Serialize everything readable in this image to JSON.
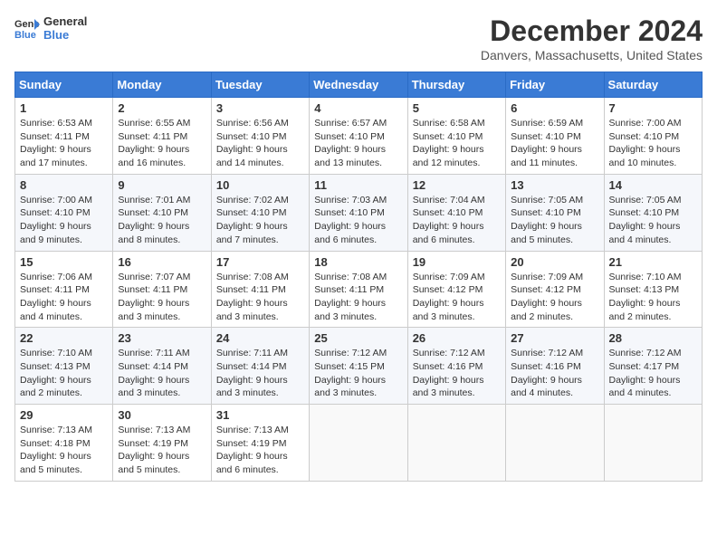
{
  "logo": {
    "line1": "General",
    "line2": "Blue"
  },
  "title": "December 2024",
  "location": "Danvers, Massachusetts, United States",
  "days_header": [
    "Sunday",
    "Monday",
    "Tuesday",
    "Wednesday",
    "Thursday",
    "Friday",
    "Saturday"
  ],
  "weeks": [
    [
      {
        "day": "1",
        "info": "Sunrise: 6:53 AM\nSunset: 4:11 PM\nDaylight: 9 hours\nand 17 minutes."
      },
      {
        "day": "2",
        "info": "Sunrise: 6:55 AM\nSunset: 4:11 PM\nDaylight: 9 hours\nand 16 minutes."
      },
      {
        "day": "3",
        "info": "Sunrise: 6:56 AM\nSunset: 4:10 PM\nDaylight: 9 hours\nand 14 minutes."
      },
      {
        "day": "4",
        "info": "Sunrise: 6:57 AM\nSunset: 4:10 PM\nDaylight: 9 hours\nand 13 minutes."
      },
      {
        "day": "5",
        "info": "Sunrise: 6:58 AM\nSunset: 4:10 PM\nDaylight: 9 hours\nand 12 minutes."
      },
      {
        "day": "6",
        "info": "Sunrise: 6:59 AM\nSunset: 4:10 PM\nDaylight: 9 hours\nand 11 minutes."
      },
      {
        "day": "7",
        "info": "Sunrise: 7:00 AM\nSunset: 4:10 PM\nDaylight: 9 hours\nand 10 minutes."
      }
    ],
    [
      {
        "day": "8",
        "info": "Sunrise: 7:00 AM\nSunset: 4:10 PM\nDaylight: 9 hours\nand 9 minutes."
      },
      {
        "day": "9",
        "info": "Sunrise: 7:01 AM\nSunset: 4:10 PM\nDaylight: 9 hours\nand 8 minutes."
      },
      {
        "day": "10",
        "info": "Sunrise: 7:02 AM\nSunset: 4:10 PM\nDaylight: 9 hours\nand 7 minutes."
      },
      {
        "day": "11",
        "info": "Sunrise: 7:03 AM\nSunset: 4:10 PM\nDaylight: 9 hours\nand 6 minutes."
      },
      {
        "day": "12",
        "info": "Sunrise: 7:04 AM\nSunset: 4:10 PM\nDaylight: 9 hours\nand 6 minutes."
      },
      {
        "day": "13",
        "info": "Sunrise: 7:05 AM\nSunset: 4:10 PM\nDaylight: 9 hours\nand 5 minutes."
      },
      {
        "day": "14",
        "info": "Sunrise: 7:05 AM\nSunset: 4:10 PM\nDaylight: 9 hours\nand 4 minutes."
      }
    ],
    [
      {
        "day": "15",
        "info": "Sunrise: 7:06 AM\nSunset: 4:11 PM\nDaylight: 9 hours\nand 4 minutes."
      },
      {
        "day": "16",
        "info": "Sunrise: 7:07 AM\nSunset: 4:11 PM\nDaylight: 9 hours\nand 3 minutes."
      },
      {
        "day": "17",
        "info": "Sunrise: 7:08 AM\nSunset: 4:11 PM\nDaylight: 9 hours\nand 3 minutes."
      },
      {
        "day": "18",
        "info": "Sunrise: 7:08 AM\nSunset: 4:11 PM\nDaylight: 9 hours\nand 3 minutes."
      },
      {
        "day": "19",
        "info": "Sunrise: 7:09 AM\nSunset: 4:12 PM\nDaylight: 9 hours\nand 3 minutes."
      },
      {
        "day": "20",
        "info": "Sunrise: 7:09 AM\nSunset: 4:12 PM\nDaylight: 9 hours\nand 2 minutes."
      },
      {
        "day": "21",
        "info": "Sunrise: 7:10 AM\nSunset: 4:13 PM\nDaylight: 9 hours\nand 2 minutes."
      }
    ],
    [
      {
        "day": "22",
        "info": "Sunrise: 7:10 AM\nSunset: 4:13 PM\nDaylight: 9 hours\nand 2 minutes."
      },
      {
        "day": "23",
        "info": "Sunrise: 7:11 AM\nSunset: 4:14 PM\nDaylight: 9 hours\nand 3 minutes."
      },
      {
        "day": "24",
        "info": "Sunrise: 7:11 AM\nSunset: 4:14 PM\nDaylight: 9 hours\nand 3 minutes."
      },
      {
        "day": "25",
        "info": "Sunrise: 7:12 AM\nSunset: 4:15 PM\nDaylight: 9 hours\nand 3 minutes."
      },
      {
        "day": "26",
        "info": "Sunrise: 7:12 AM\nSunset: 4:16 PM\nDaylight: 9 hours\nand 3 minutes."
      },
      {
        "day": "27",
        "info": "Sunrise: 7:12 AM\nSunset: 4:16 PM\nDaylight: 9 hours\nand 4 minutes."
      },
      {
        "day": "28",
        "info": "Sunrise: 7:12 AM\nSunset: 4:17 PM\nDaylight: 9 hours\nand 4 minutes."
      }
    ],
    [
      {
        "day": "29",
        "info": "Sunrise: 7:13 AM\nSunset: 4:18 PM\nDaylight: 9 hours\nand 5 minutes."
      },
      {
        "day": "30",
        "info": "Sunrise: 7:13 AM\nSunset: 4:19 PM\nDaylight: 9 hours\nand 5 minutes."
      },
      {
        "day": "31",
        "info": "Sunrise: 7:13 AM\nSunset: 4:19 PM\nDaylight: 9 hours\nand 6 minutes."
      },
      {
        "day": "",
        "info": ""
      },
      {
        "day": "",
        "info": ""
      },
      {
        "day": "",
        "info": ""
      },
      {
        "day": "",
        "info": ""
      }
    ]
  ]
}
